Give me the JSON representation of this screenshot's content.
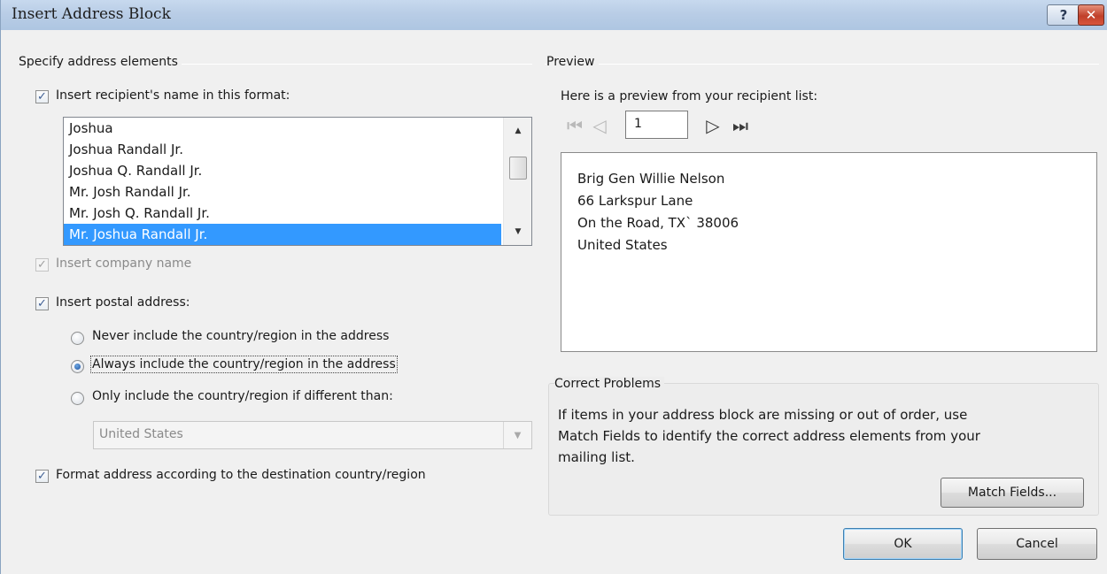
{
  "window": {
    "title": "Insert Address Block",
    "help_glyph": "?",
    "close_glyph": "✕"
  },
  "address_elements": {
    "group_label": "Specify address elements",
    "recipient_name": {
      "checked": true,
      "label": "Insert recipient's name in this format:",
      "formats": [
        "Joshua",
        "Joshua Randall Jr.",
        "Joshua Q. Randall Jr.",
        "Mr. Josh Randall Jr.",
        "Mr. Josh Q. Randall Jr.",
        "Mr. Joshua Randall Jr."
      ],
      "selected_format": "Mr. Joshua Randall Jr."
    },
    "company_name": {
      "checked": true,
      "enabled": false,
      "label": "Insert company name"
    },
    "postal_address": {
      "checked": true,
      "label": "Insert postal address:",
      "options": [
        {
          "label": "Never include the country/region in the address",
          "selected": false
        },
        {
          "label": "Always include the country/region in the address",
          "selected": true
        },
        {
          "label": "Only include the country/region if different than:",
          "selected": false
        }
      ],
      "country_value": "United States"
    },
    "format_by_country": {
      "checked": true,
      "label": "Format address according to the destination country/region"
    }
  },
  "preview": {
    "group_label": "Preview",
    "intro": "Here is a preview from your recipient list:",
    "record_number": "1",
    "address_lines": [
      "Brig Gen Willie Nelson",
      "66 Larkspur Lane",
      "On the Road, TX` 38006",
      "United States"
    ]
  },
  "correct_problems": {
    "group_label": "Correct Problems",
    "text_lines": [
      "If items in your address block are missing or out of order, use",
      "Match Fields to identify the correct address elements from your",
      "mailing list."
    ],
    "match_fields_label": "Match Fields..."
  },
  "buttons": {
    "ok_label": "OK",
    "cancel_label": "Cancel"
  },
  "colors": {
    "selection": "#3399ff",
    "titlebar": "#b9cde6",
    "close_button": "#c0402a"
  }
}
